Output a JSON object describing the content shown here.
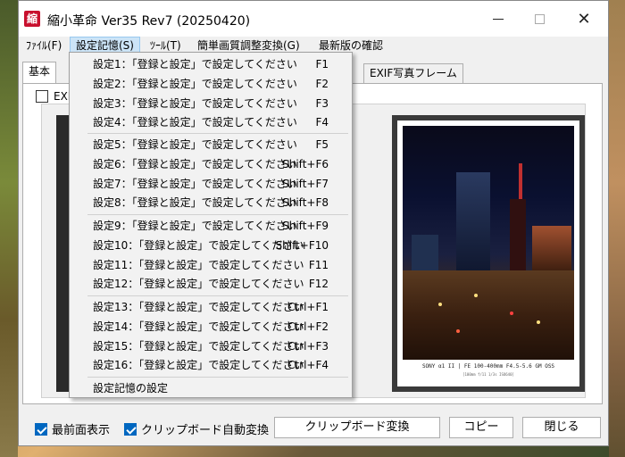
{
  "window": {
    "icon_char": "縮",
    "title": "縮小革命 Ver35 Rev7 (20250420)"
  },
  "menubar": {
    "items": [
      "ﾌｧｲﾙ(F)",
      "設定記憶(S)",
      "ﾂｰﾙ(T)",
      "簡単画質調整変換(G)",
      "最新版の確認"
    ]
  },
  "tabs": {
    "items": [
      "基本",
      "EXIF写真フレーム"
    ]
  },
  "panel": {
    "exif_checkbox_label": "EXI",
    "photo_caption": "SONY α1 II | FE 100-400mm F4.5-5.6 GM OSS",
    "photo_caption_sub": "[100mm f/11 1/3s ISO640]"
  },
  "dropdown": {
    "items": [
      {
        "label": "設定1：「登録と設定」で設定してください",
        "key": "F1"
      },
      {
        "label": "設定2：「登録と設定」で設定してください",
        "key": "F2"
      },
      {
        "label": "設定3：「登録と設定」で設定してください",
        "key": "F3"
      },
      {
        "label": "設定4：「登録と設定」で設定してください",
        "key": "F4"
      },
      {
        "label": "設定5：「登録と設定」で設定してください",
        "key": "F5"
      },
      {
        "label": "設定6：「登録と設定」で設定してください",
        "key": "Shift+F6"
      },
      {
        "label": "設定7：「登録と設定」で設定してください",
        "key": "Shift+F7"
      },
      {
        "label": "設定8：「登録と設定」で設定してください",
        "key": "Shift+F8"
      },
      {
        "label": "設定9：「登録と設定」で設定してください",
        "key": "Shift+F9"
      },
      {
        "label": "設定10：「登録と設定」で設定してください",
        "key": "Shift+F10"
      },
      {
        "label": "設定11：「登録と設定」で設定してください",
        "key": "F11"
      },
      {
        "label": "設定12：「登録と設定」で設定してください",
        "key": "F12"
      },
      {
        "label": "設定13：「登録と設定」で設定してください",
        "key": "Ctrl+F1"
      },
      {
        "label": "設定14：「登録と設定」で設定してください",
        "key": "Ctrl+F2"
      },
      {
        "label": "設定15：「登録と設定」で設定してください",
        "key": "Ctrl+F3"
      },
      {
        "label": "設定16：「登録と設定」で設定してください",
        "key": "Ctrl+F4"
      }
    ],
    "footer": "設定記憶の設定"
  },
  "bottom": {
    "topmost_label": "最前面表示",
    "clipboard_auto_label": "クリップボード自動変換",
    "clipboard_convert_button": "クリップボード変換",
    "copy_button": "コピー",
    "close_button": "閉じる"
  }
}
